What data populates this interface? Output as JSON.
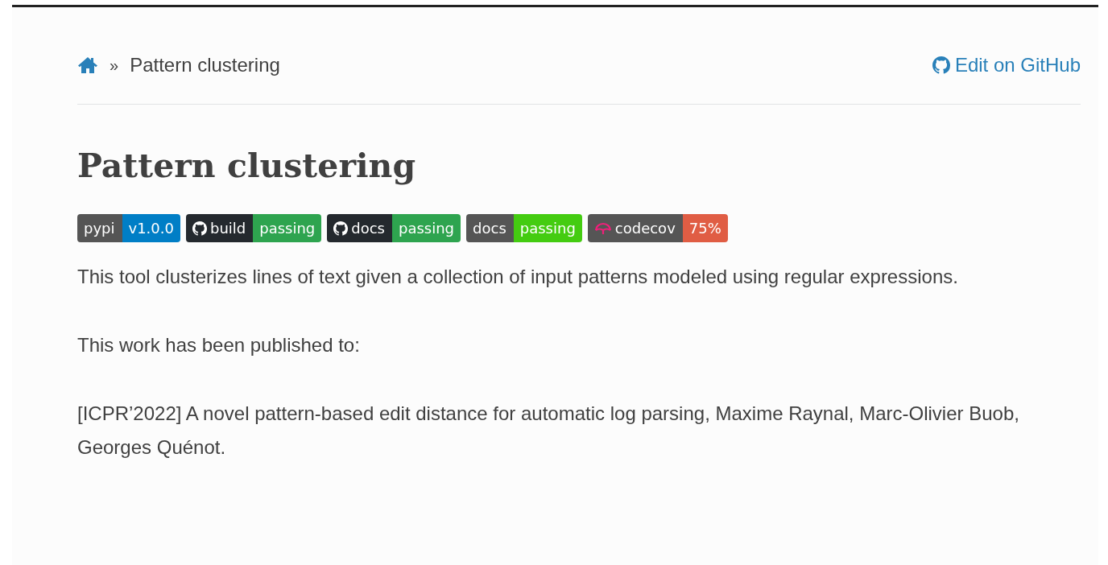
{
  "breadcrumb": {
    "separator": "»",
    "current": "Pattern clustering",
    "edit_link": "Edit on GitHub"
  },
  "title": "Pattern clustering",
  "badges": [
    {
      "kind": "plain",
      "label": "pypi",
      "value": "v1.0.0",
      "color": "#007ec6"
    },
    {
      "kind": "github",
      "label": "build",
      "value": "passing",
      "color": "#2ea44f"
    },
    {
      "kind": "github",
      "label": "docs",
      "value": "passing",
      "color": "#2ea44f"
    },
    {
      "kind": "plain",
      "label": "docs",
      "value": "passing",
      "color": "#44cc11"
    },
    {
      "kind": "codecov",
      "label": "codecov",
      "value": "75%",
      "color": "#e05d44"
    }
  ],
  "paragraphs": [
    "This tool clusterizes lines of text given a collection of input patterns modeled using regular expressions.",
    "This work has been published to:",
    "[ICPR’2022] A novel pattern-based edit distance for automatic log parsing, Maxime Raynal, Marc-Olivier Buob, Georges Quénot."
  ]
}
